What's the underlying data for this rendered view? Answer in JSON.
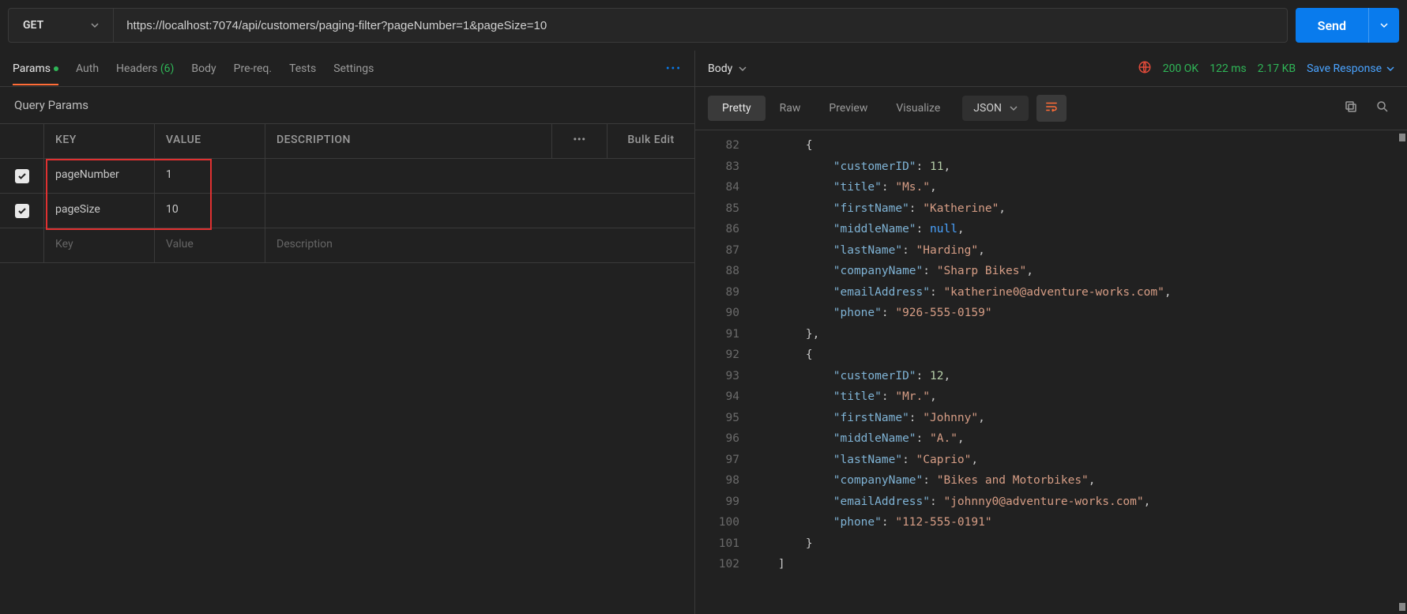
{
  "request": {
    "method": "GET",
    "url": "https://localhost:7074/api/customers/paging-filter?pageNumber=1&pageSize=10",
    "send_label": "Send"
  },
  "left_tabs": {
    "params": "Params",
    "auth": "Auth",
    "headers": "Headers",
    "headers_count": "(6)",
    "body": "Body",
    "prereq": "Pre-req.",
    "tests": "Tests",
    "settings": "Settings"
  },
  "query_params": {
    "title": "Query Params",
    "head_key": "KEY",
    "head_value": "VALUE",
    "head_desc": "DESCRIPTION",
    "bulk_edit": "Bulk Edit",
    "rows": [
      {
        "key": "pageNumber",
        "value": "1"
      },
      {
        "key": "pageSize",
        "value": "10"
      }
    ],
    "ph_key": "Key",
    "ph_value": "Value",
    "ph_desc": "Description"
  },
  "response": {
    "body_label": "Body",
    "status": "200 OK",
    "time": "122 ms",
    "size": "2.17 KB",
    "save": "Save Response",
    "view_tabs": {
      "pretty": "Pretty",
      "raw": "Raw",
      "preview": "Preview",
      "visualize": "Visualize"
    },
    "format": "JSON",
    "lines": [
      {
        "n": 82,
        "indent": 2,
        "tokens": [
          {
            "t": "brace",
            "v": "{"
          }
        ]
      },
      {
        "n": 83,
        "indent": 3,
        "tokens": [
          {
            "t": "key",
            "v": "\"customerID\""
          },
          {
            "t": "punc",
            "v": ": "
          },
          {
            "t": "num",
            "v": "11"
          },
          {
            "t": "punc",
            "v": ","
          }
        ]
      },
      {
        "n": 84,
        "indent": 3,
        "tokens": [
          {
            "t": "key",
            "v": "\"title\""
          },
          {
            "t": "punc",
            "v": ": "
          },
          {
            "t": "str",
            "v": "\"Ms.\""
          },
          {
            "t": "punc",
            "v": ","
          }
        ]
      },
      {
        "n": 85,
        "indent": 3,
        "tokens": [
          {
            "t": "key",
            "v": "\"firstName\""
          },
          {
            "t": "punc",
            "v": ": "
          },
          {
            "t": "str",
            "v": "\"Katherine\""
          },
          {
            "t": "punc",
            "v": ","
          }
        ]
      },
      {
        "n": 86,
        "indent": 3,
        "tokens": [
          {
            "t": "key",
            "v": "\"middleName\""
          },
          {
            "t": "punc",
            "v": ": "
          },
          {
            "t": "null",
            "v": "null"
          },
          {
            "t": "punc",
            "v": ","
          }
        ]
      },
      {
        "n": 87,
        "indent": 3,
        "tokens": [
          {
            "t": "key",
            "v": "\"lastName\""
          },
          {
            "t": "punc",
            "v": ": "
          },
          {
            "t": "str",
            "v": "\"Harding\""
          },
          {
            "t": "punc",
            "v": ","
          }
        ]
      },
      {
        "n": 88,
        "indent": 3,
        "tokens": [
          {
            "t": "key",
            "v": "\"companyName\""
          },
          {
            "t": "punc",
            "v": ": "
          },
          {
            "t": "str",
            "v": "\"Sharp Bikes\""
          },
          {
            "t": "punc",
            "v": ","
          }
        ]
      },
      {
        "n": 89,
        "indent": 3,
        "tokens": [
          {
            "t": "key",
            "v": "\"emailAddress\""
          },
          {
            "t": "punc",
            "v": ": "
          },
          {
            "t": "str",
            "v": "\"katherine0@adventure-works.com\""
          },
          {
            "t": "punc",
            "v": ","
          }
        ]
      },
      {
        "n": 90,
        "indent": 3,
        "tokens": [
          {
            "t": "key",
            "v": "\"phone\""
          },
          {
            "t": "punc",
            "v": ": "
          },
          {
            "t": "str",
            "v": "\"926-555-0159\""
          }
        ]
      },
      {
        "n": 91,
        "indent": 2,
        "tokens": [
          {
            "t": "brace",
            "v": "}"
          },
          {
            "t": "punc",
            "v": ","
          }
        ]
      },
      {
        "n": 92,
        "indent": 2,
        "tokens": [
          {
            "t": "brace",
            "v": "{"
          }
        ]
      },
      {
        "n": 93,
        "indent": 3,
        "tokens": [
          {
            "t": "key",
            "v": "\"customerID\""
          },
          {
            "t": "punc",
            "v": ": "
          },
          {
            "t": "num",
            "v": "12"
          },
          {
            "t": "punc",
            "v": ","
          }
        ]
      },
      {
        "n": 94,
        "indent": 3,
        "tokens": [
          {
            "t": "key",
            "v": "\"title\""
          },
          {
            "t": "punc",
            "v": ": "
          },
          {
            "t": "str",
            "v": "\"Mr.\""
          },
          {
            "t": "punc",
            "v": ","
          }
        ]
      },
      {
        "n": 95,
        "indent": 3,
        "tokens": [
          {
            "t": "key",
            "v": "\"firstName\""
          },
          {
            "t": "punc",
            "v": ": "
          },
          {
            "t": "str",
            "v": "\"Johnny\""
          },
          {
            "t": "punc",
            "v": ","
          }
        ]
      },
      {
        "n": 96,
        "indent": 3,
        "tokens": [
          {
            "t": "key",
            "v": "\"middleName\""
          },
          {
            "t": "punc",
            "v": ": "
          },
          {
            "t": "str",
            "v": "\"A.\""
          },
          {
            "t": "punc",
            "v": ","
          }
        ]
      },
      {
        "n": 97,
        "indent": 3,
        "tokens": [
          {
            "t": "key",
            "v": "\"lastName\""
          },
          {
            "t": "punc",
            "v": ": "
          },
          {
            "t": "str",
            "v": "\"Caprio\""
          },
          {
            "t": "punc",
            "v": ","
          }
        ]
      },
      {
        "n": 98,
        "indent": 3,
        "tokens": [
          {
            "t": "key",
            "v": "\"companyName\""
          },
          {
            "t": "punc",
            "v": ": "
          },
          {
            "t": "str",
            "v": "\"Bikes and Motorbikes\""
          },
          {
            "t": "punc",
            "v": ","
          }
        ]
      },
      {
        "n": 99,
        "indent": 3,
        "tokens": [
          {
            "t": "key",
            "v": "\"emailAddress\""
          },
          {
            "t": "punc",
            "v": ": "
          },
          {
            "t": "str",
            "v": "\"johnny0@adventure-works.com\""
          },
          {
            "t": "punc",
            "v": ","
          }
        ]
      },
      {
        "n": 100,
        "indent": 3,
        "tokens": [
          {
            "t": "key",
            "v": "\"phone\""
          },
          {
            "t": "punc",
            "v": ": "
          },
          {
            "t": "str",
            "v": "\"112-555-0191\""
          }
        ]
      },
      {
        "n": 101,
        "indent": 2,
        "tokens": [
          {
            "t": "brace",
            "v": "}"
          }
        ]
      },
      {
        "n": 102,
        "indent": 1,
        "tokens": [
          {
            "t": "brace",
            "v": "]"
          }
        ]
      }
    ]
  }
}
